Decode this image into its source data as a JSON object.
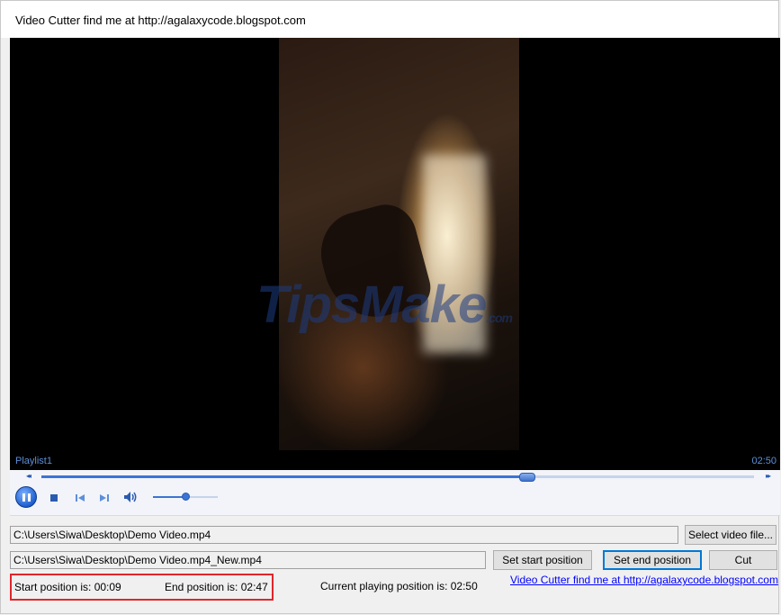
{
  "window": {
    "title": "Video Cutter find me at http://agalaxycode.blogspot.com"
  },
  "player": {
    "watermark": "TipsMake",
    "watermark_suffix": ".com",
    "playlist_label": "Playlist1",
    "duration": "02:50",
    "seek_progress": 0.68,
    "volume_level": 0.5,
    "rewind_glyph": "◂◂",
    "forward_glyph": "▸▸",
    "icons": [
      "pause-icon",
      "stop-icon",
      "previous-icon",
      "next-icon",
      "speaker-icon"
    ]
  },
  "form": {
    "source_path": "C:\\Users\\Siwa\\Desktop\\Demo Video.mp4",
    "select_button": "Select video file...",
    "output_path": "C:\\Users\\Siwa\\Desktop\\Demo Video.mp4_New.mp4",
    "set_start_button": "Set start position",
    "set_end_button": "Set end position",
    "cut_button": "Cut",
    "start_position": "Start position is: 00:09",
    "end_position": "End position is: 02:47",
    "current_position": "Current playing position is: 02:50",
    "link_text": "Video Cutter find me at http://agalaxycode.blogspot.com"
  },
  "colors": {
    "accent": "#3c74d4",
    "highlight": "#e0262c",
    "link": "#0000ff"
  }
}
